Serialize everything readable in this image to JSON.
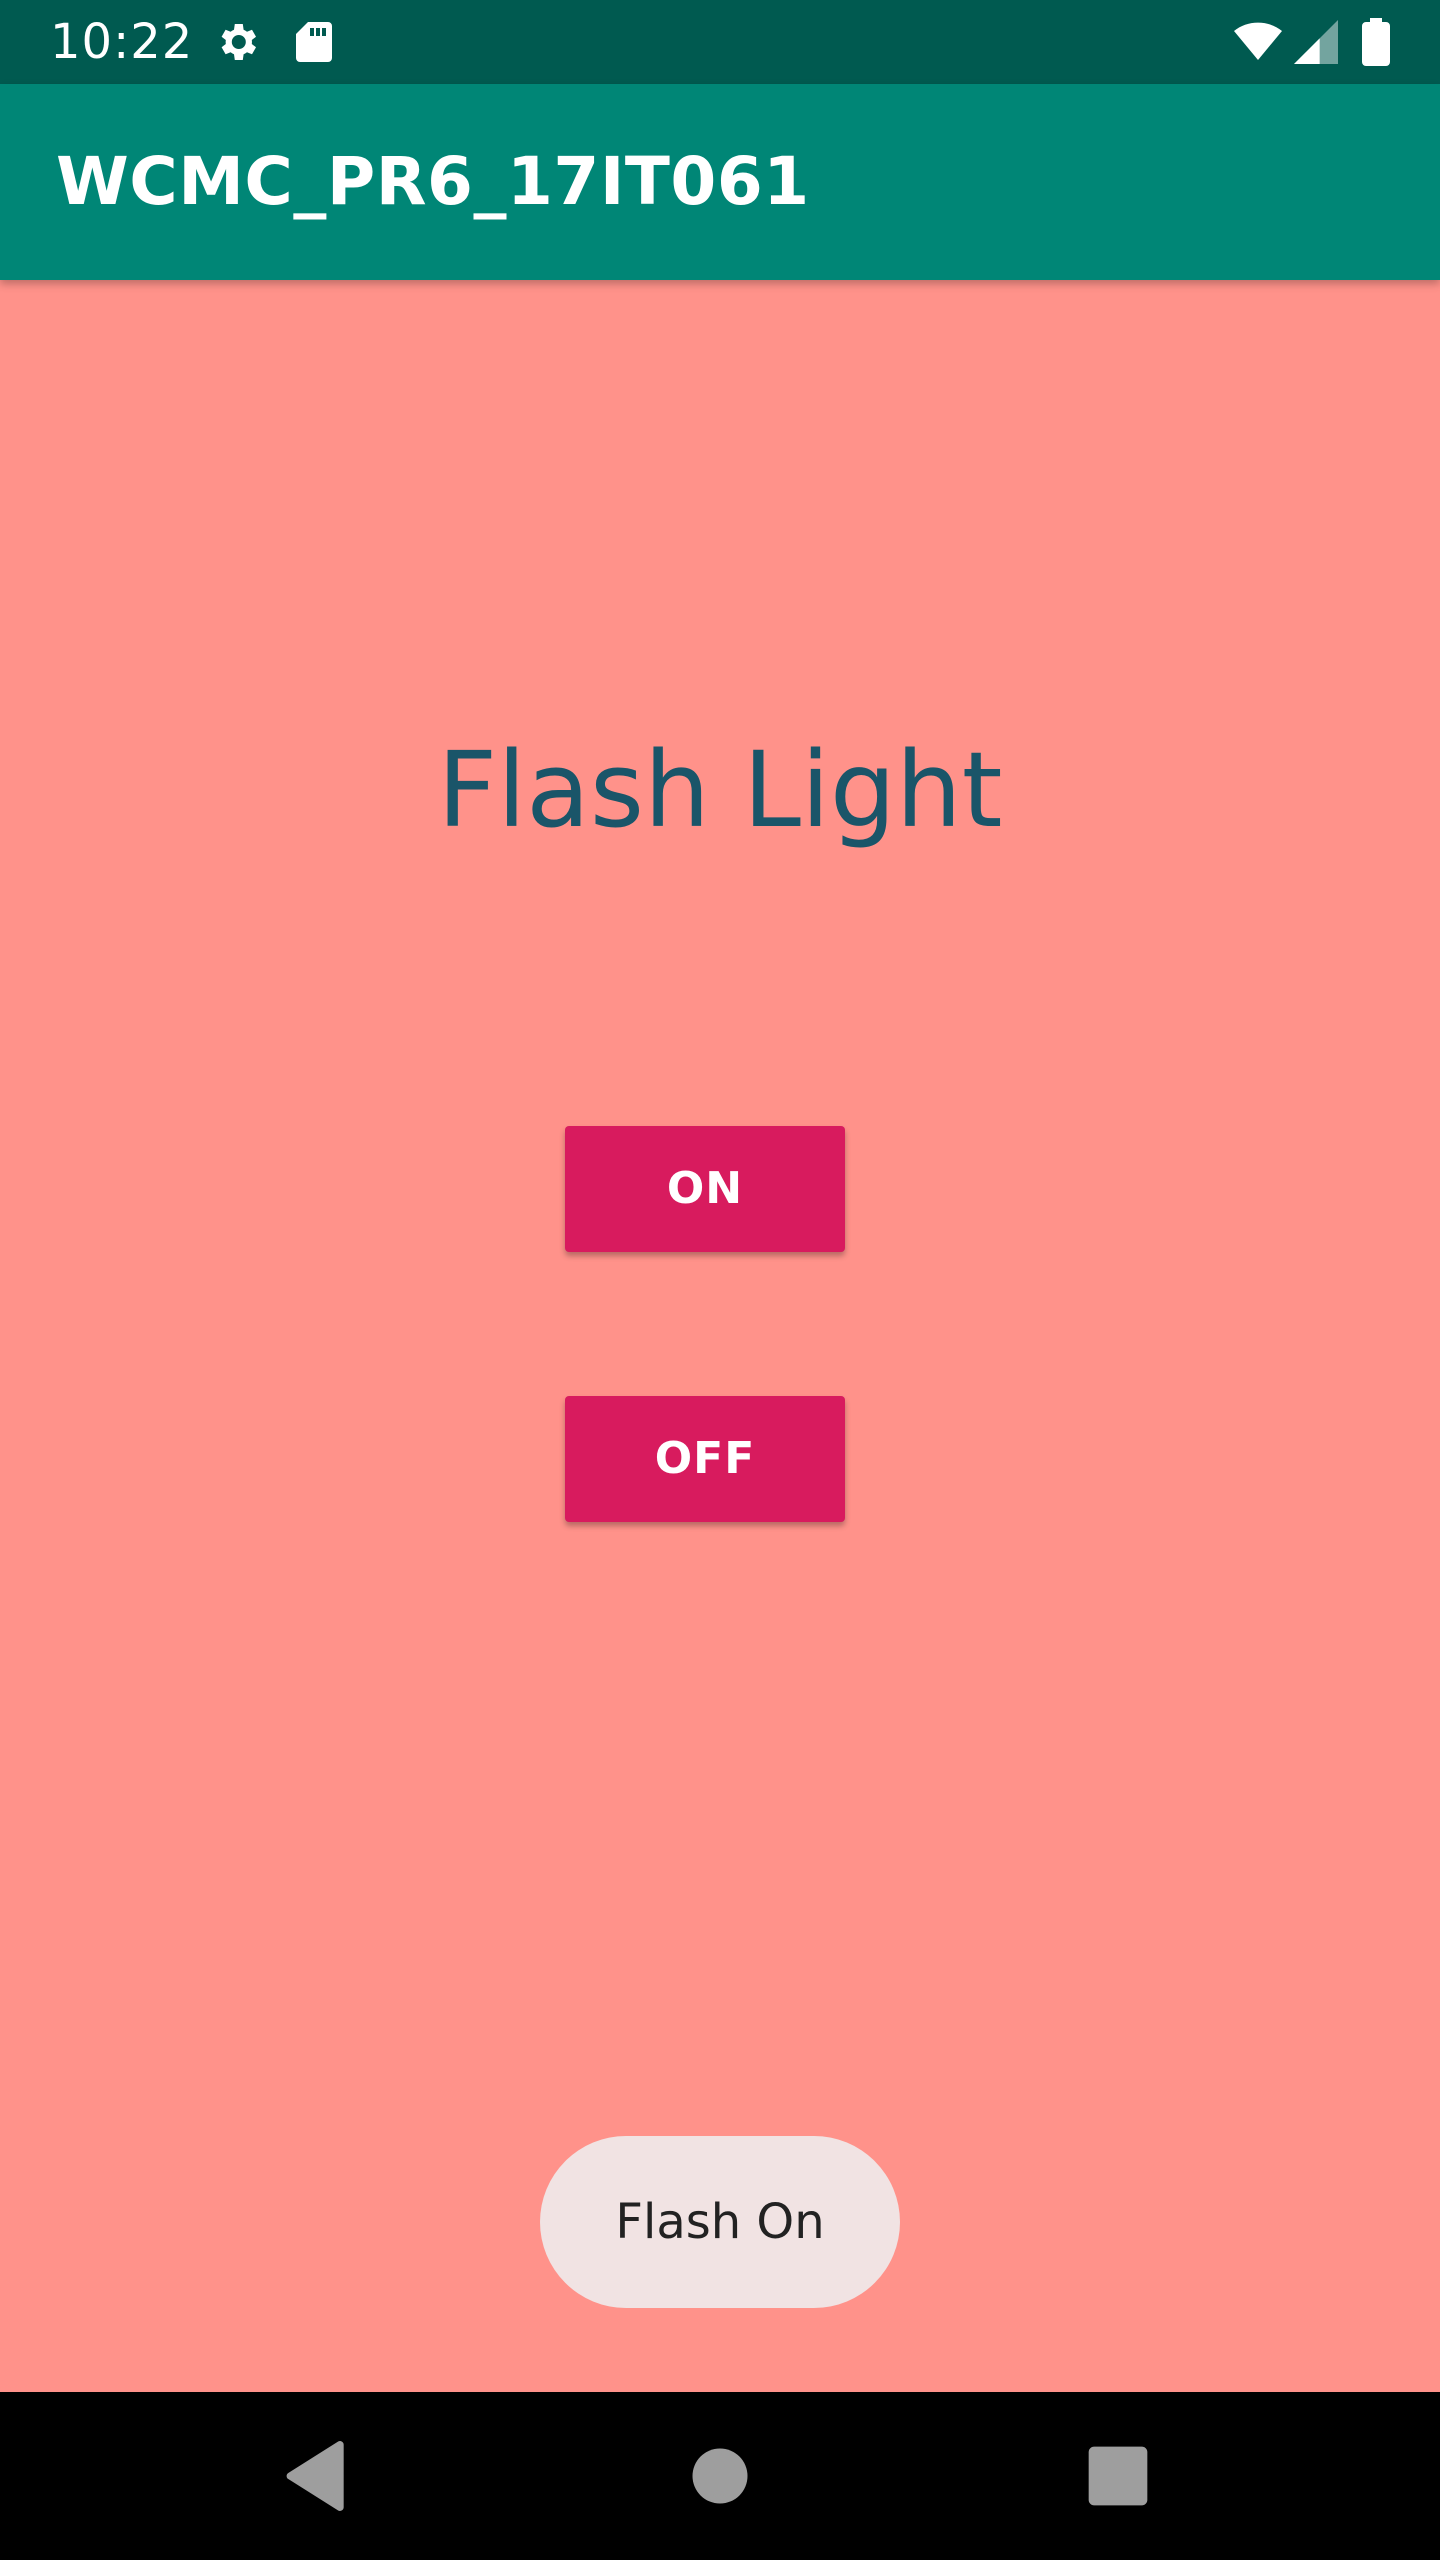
{
  "status_bar": {
    "time": "10:22",
    "icons": [
      "gear-icon",
      "sd-card-icon",
      "wifi-icon",
      "cell-signal-icon",
      "battery-icon"
    ]
  },
  "app_bar": {
    "title": "WCMC_PR6_17IT061"
  },
  "main": {
    "heading": "Flash Light",
    "on_button_label": "ON",
    "off_button_label": "OFF"
  },
  "toast": {
    "message": "Flash On"
  },
  "nav_bar": {
    "icons": [
      "back-icon",
      "home-icon",
      "recents-icon"
    ]
  },
  "colors": {
    "background": "#ff928a",
    "status_bar": "#005a50",
    "app_bar": "#008676",
    "heading_text": "#1a5569",
    "button": "#d81b5e",
    "toast": "#f1e3e3"
  }
}
